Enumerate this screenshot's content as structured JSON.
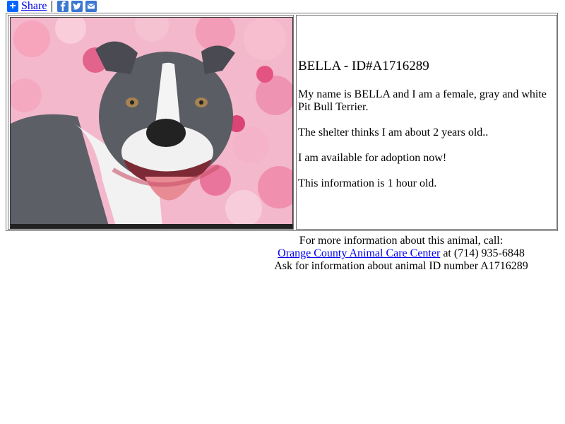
{
  "share": {
    "label": "Share",
    "icons": [
      "plus-icon",
      "facebook-icon",
      "twitter-icon",
      "email-icon"
    ],
    "colors": {
      "accent": "#0166ff",
      "social": "#3b77d1",
      "link": "#0000ee"
    }
  },
  "animal": {
    "title": "BELLA - ID#A1716289",
    "description": "My name is BELLA and I am a female, gray and white Pit Bull Terrier.",
    "age": "The shelter thinks I am about 2 years old..",
    "availability": "I am available for adoption now!",
    "freshness": "This information is 1 hour old."
  },
  "footer": {
    "line1": "For more information about this animal, call:",
    "shelter_link": "Orange County Animal Care Center",
    "phone_text": " at (714) 935-6848",
    "line3": "Ask for information about animal ID number A1716289"
  }
}
